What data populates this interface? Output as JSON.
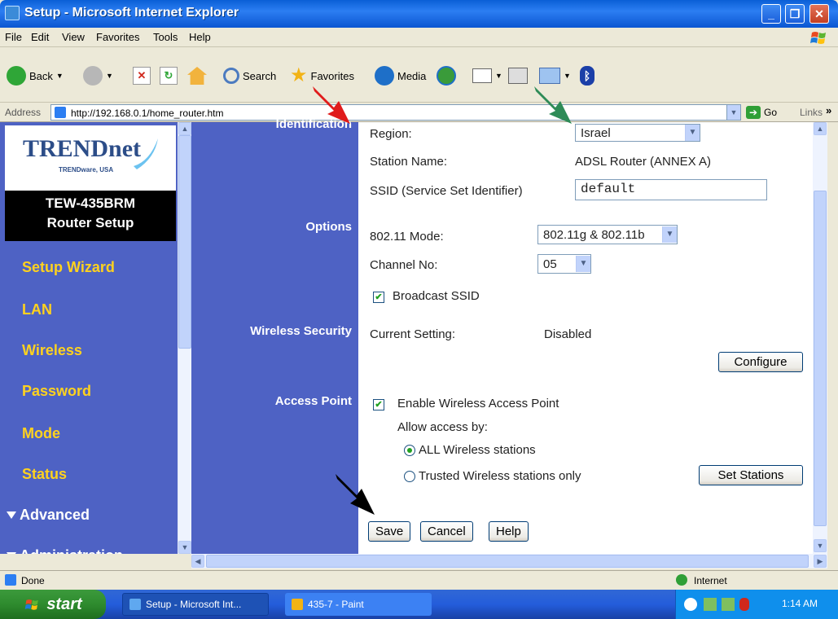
{
  "window": {
    "title": "Setup - Microsoft Internet Explorer",
    "minimize": "_",
    "maximize": "❐",
    "close": "✕"
  },
  "menu": [
    "File",
    "Edit",
    "View",
    "Favorites",
    "Tools",
    "Help"
  ],
  "toolbar": {
    "back": "Back",
    "search": "Search",
    "favorites": "Favorites",
    "media": "Media"
  },
  "address": {
    "label": "Address",
    "url": "http://192.168.0.1/home_router.htm",
    "go": "Go",
    "links": "Links"
  },
  "sidebar": {
    "logo": "TRENDnet",
    "logo_sub": "TRENDware, USA",
    "model": "TEW-435BRM",
    "model_sub": "Router Setup",
    "links": [
      "Setup Wizard",
      "LAN",
      "Wireless",
      "Password",
      "Mode",
      "Status"
    ],
    "groups": [
      "Advanced",
      "Administration"
    ]
  },
  "sections": {
    "identification": "Identification",
    "options": "Options",
    "wireless_security": "Wireless Security",
    "access_point": "Access Point"
  },
  "form": {
    "region_label": "Region:",
    "region_value": "Israel",
    "station_label": "Station Name:",
    "station_value": "ADSL Router (ANNEX A)",
    "ssid_label": "SSID (Service Set Identifier)",
    "ssid_value": "default",
    "mode_label": "802.11 Mode:",
    "mode_value": "802.11g & 802.11b",
    "channel_label": "Channel No:",
    "channel_value": "05",
    "broadcast_label": "Broadcast SSID",
    "broadcast_checked": true,
    "current_setting_label": "Current Setting:",
    "current_setting_value": "Disabled",
    "configure": "Configure",
    "enable_ap_label": "Enable Wireless Access Point",
    "enable_ap_checked": true,
    "allow_label": "Allow access by:",
    "all_stations": "ALL Wireless stations",
    "trusted_stations": "Trusted Wireless stations only",
    "set_stations": "Set Stations",
    "save": "Save",
    "cancel": "Cancel",
    "help": "Help"
  },
  "status": {
    "left": "Done",
    "zone": "Internet"
  },
  "taskbar": {
    "start": "start",
    "tasks": [
      "Setup - Microsoft Int...",
      "435-7 - Paint"
    ],
    "clock": "1:14 AM"
  },
  "colors": {
    "nav_bg": "#4E62C4",
    "nav_link": "#FFD21E",
    "title_bar": "#0A5FD6",
    "taskbar": "#245DDB",
    "start_button": "#2E8B2E"
  },
  "annotation_arrows": [
    "red",
    "green",
    "black"
  ]
}
